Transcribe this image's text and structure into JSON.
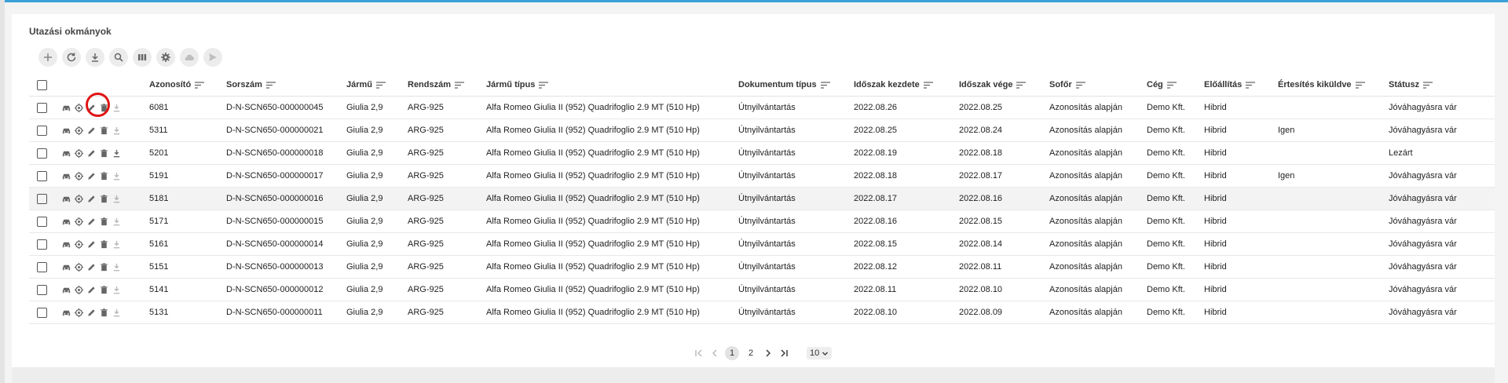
{
  "page": {
    "title": "Utazási okmányok"
  },
  "toolbar": [
    "add-icon",
    "refresh-icon",
    "download-icon",
    "search-icon",
    "columns-icon",
    "settings-icon",
    "cloud-icon",
    "send-icon"
  ],
  "columns": {
    "azonosito": "Azonosító",
    "sorszam": "Sorszám",
    "jarmu": "Jármű",
    "rendszam": "Rendszám",
    "jarmu_tipus": "Jármű típus",
    "dokumentum_tipus": "Dokumentum típus",
    "idoszak_kezdete": "Időszak kezdete",
    "idoszak_vege": "Időszak vége",
    "sofor": "Sofőr",
    "ceg": "Cég",
    "eloallitas": "Előállítás",
    "ertesites": "Értesítés kiküldve",
    "statusz": "Státusz"
  },
  "rows": [
    {
      "id": "6081",
      "sorszam": "D-N-SCN650-000000045",
      "jarmu": "Giulia 2,9",
      "rendszam": "ARG-925",
      "tipus": "Alfa Romeo Giulia II (952) Quadrifoglio 2.9 MT (510 Hp)",
      "dok": "Útnyilvántartás",
      "kezd": "2022.08.26",
      "vege": "2022.08.25",
      "sofor": "Azonosítás alapján",
      "ceg": "Demo Kft.",
      "elo": "Hibrid",
      "ert": "",
      "statusz": "Jóváhagyásra vár",
      "download_active": false
    },
    {
      "id": "5311",
      "sorszam": "D-N-SCN650-000000021",
      "jarmu": "Giulia 2,9",
      "rendszam": "ARG-925",
      "tipus": "Alfa Romeo Giulia II (952) Quadrifoglio 2.9 MT (510 Hp)",
      "dok": "Útnyilvántartás",
      "kezd": "2022.08.25",
      "vege": "2022.08.24",
      "sofor": "Azonosítás alapján",
      "ceg": "Demo Kft.",
      "elo": "Hibrid",
      "ert": "Igen",
      "statusz": "Jóváhagyásra vár",
      "download_active": false
    },
    {
      "id": "5201",
      "sorszam": "D-N-SCN650-000000018",
      "jarmu": "Giulia 2,9",
      "rendszam": "ARG-925",
      "tipus": "Alfa Romeo Giulia II (952) Quadrifoglio 2.9 MT (510 Hp)",
      "dok": "Útnyilvántartás",
      "kezd": "2022.08.19",
      "vege": "2022.08.18",
      "sofor": "Azonosítás alapján",
      "ceg": "Demo Kft.",
      "elo": "Hibrid",
      "ert": "",
      "statusz": "Lezárt",
      "download_active": true
    },
    {
      "id": "5191",
      "sorszam": "D-N-SCN650-000000017",
      "jarmu": "Giulia 2,9",
      "rendszam": "ARG-925",
      "tipus": "Alfa Romeo Giulia II (952) Quadrifoglio 2.9 MT (510 Hp)",
      "dok": "Útnyilvántartás",
      "kezd": "2022.08.18",
      "vege": "2022.08.17",
      "sofor": "Azonosítás alapján",
      "ceg": "Demo Kft.",
      "elo": "Hibrid",
      "ert": "Igen",
      "statusz": "Jóváhagyásra vár",
      "download_active": false
    },
    {
      "id": "5181",
      "sorszam": "D-N-SCN650-000000016",
      "jarmu": "Giulia 2,9",
      "rendszam": "ARG-925",
      "tipus": "Alfa Romeo Giulia II (952) Quadrifoglio 2.9 MT (510 Hp)",
      "dok": "Útnyilvántartás",
      "kezd": "2022.08.17",
      "vege": "2022.08.16",
      "sofor": "Azonosítás alapján",
      "ceg": "Demo Kft.",
      "elo": "Hibrid",
      "ert": "",
      "statusz": "Jóváhagyásra vár",
      "download_active": false
    },
    {
      "id": "5171",
      "sorszam": "D-N-SCN650-000000015",
      "jarmu": "Giulia 2,9",
      "rendszam": "ARG-925",
      "tipus": "Alfa Romeo Giulia II (952) Quadrifoglio 2.9 MT (510 Hp)",
      "dok": "Útnyilvántartás",
      "kezd": "2022.08.16",
      "vege": "2022.08.15",
      "sofor": "Azonosítás alapján",
      "ceg": "Demo Kft.",
      "elo": "Hibrid",
      "ert": "",
      "statusz": "Jóváhagyásra vár",
      "download_active": false
    },
    {
      "id": "5161",
      "sorszam": "D-N-SCN650-000000014",
      "jarmu": "Giulia 2,9",
      "rendszam": "ARG-925",
      "tipus": "Alfa Romeo Giulia II (952) Quadrifoglio 2.9 MT (510 Hp)",
      "dok": "Útnyilvántartás",
      "kezd": "2022.08.15",
      "vege": "2022.08.14",
      "sofor": "Azonosítás alapján",
      "ceg": "Demo Kft.",
      "elo": "Hibrid",
      "ert": "",
      "statusz": "Jóváhagyásra vár",
      "download_active": false
    },
    {
      "id": "5151",
      "sorszam": "D-N-SCN650-000000013",
      "jarmu": "Giulia 2,9",
      "rendszam": "ARG-925",
      "tipus": "Alfa Romeo Giulia II (952) Quadrifoglio 2.9 MT (510 Hp)",
      "dok": "Útnyilvántartás",
      "kezd": "2022.08.12",
      "vege": "2022.08.11",
      "sofor": "Azonosítás alapján",
      "ceg": "Demo Kft.",
      "elo": "Hibrid",
      "ert": "",
      "statusz": "Jóváhagyásra vár",
      "download_active": false
    },
    {
      "id": "5141",
      "sorszam": "D-N-SCN650-000000012",
      "jarmu": "Giulia 2,9",
      "rendszam": "ARG-925",
      "tipus": "Alfa Romeo Giulia II (952) Quadrifoglio 2.9 MT (510 Hp)",
      "dok": "Útnyilvántartás",
      "kezd": "2022.08.11",
      "vege": "2022.08.10",
      "sofor": "Azonosítás alapján",
      "ceg": "Demo Kft.",
      "elo": "Hibrid",
      "ert": "",
      "statusz": "Jóváhagyásra vár",
      "download_active": false
    },
    {
      "id": "5131",
      "sorszam": "D-N-SCN650-000000011",
      "jarmu": "Giulia 2,9",
      "rendszam": "ARG-925",
      "tipus": "Alfa Romeo Giulia II (952) Quadrifoglio 2.9 MT (510 Hp)",
      "dok": "Útnyilvántartás",
      "kezd": "2022.08.10",
      "vege": "2022.08.09",
      "sofor": "Azonosítás alapján",
      "ceg": "Demo Kft.",
      "elo": "Hibrid",
      "ert": "",
      "statusz": "Jóváhagyásra vár",
      "download_active": false
    }
  ],
  "pagination": {
    "pages": [
      "1",
      "2"
    ],
    "current": "1",
    "page_size": "10"
  },
  "colors": {
    "accent": "#3aa0d8",
    "highlight": "#e01414"
  }
}
